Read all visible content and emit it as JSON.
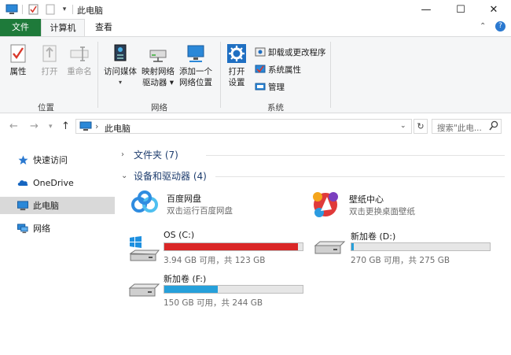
{
  "window": {
    "title": "此电脑",
    "controls": {
      "minimize": "—",
      "maximize": "☐",
      "close": "✕"
    }
  },
  "tabs": [
    {
      "label": "文件"
    },
    {
      "label": "计算机"
    },
    {
      "label": "查看"
    }
  ],
  "ribbon": {
    "location_group": {
      "label": "位置",
      "buttons": [
        {
          "label": "属性"
        },
        {
          "label": "打开"
        },
        {
          "label": "重命名"
        }
      ]
    },
    "network_group": {
      "label": "网络",
      "buttons": [
        {
          "label": "访问媒体"
        },
        {
          "label": "映射网络",
          "label2": "驱动器 ▾"
        },
        {
          "label": "添加一个",
          "label2": "网络位置"
        }
      ]
    },
    "system_group": {
      "label": "系统",
      "open_settings": {
        "label": "打开",
        "label2": "设置"
      },
      "items": [
        {
          "label": "卸载或更改程序"
        },
        {
          "label": "系统属性"
        },
        {
          "label": "管理"
        }
      ]
    }
  },
  "address": {
    "path": "此电脑",
    "search_placeholder": "搜索\"此电...",
    "separator": "›"
  },
  "nav_pane": [
    {
      "label": "快速访问"
    },
    {
      "label": "OneDrive"
    },
    {
      "label": "此电脑"
    },
    {
      "label": "网络"
    }
  ],
  "content": {
    "folders_group": "文件夹 (7)",
    "devices_group": "设备和驱动器 (4)",
    "apps": [
      {
        "name": "百度网盘",
        "desc": "双击运行百度网盘"
      },
      {
        "name": "壁纸中心",
        "desc": "双击更换桌面壁纸"
      }
    ],
    "drives": [
      {
        "name": "OS (C:)",
        "info": "3.94 GB 可用，共 123 GB",
        "used_fraction": 0.968,
        "bar_color": "#da2626"
      },
      {
        "name": "新加卷 (D:)",
        "info": "270 GB 可用，共 275 GB",
        "used_fraction": 0.018,
        "bar_color": "#26a0da"
      },
      {
        "name": "新加卷 (F:)",
        "info": "150 GB 可用，共 244 GB",
        "used_fraction": 0.385,
        "bar_color": "#26a0da"
      }
    ]
  },
  "colors": {
    "file_tab": "#1e7a3a",
    "bar_normal": "#26a0da",
    "bar_full": "#da2626",
    "nav_selected": "#d9d9d9"
  }
}
